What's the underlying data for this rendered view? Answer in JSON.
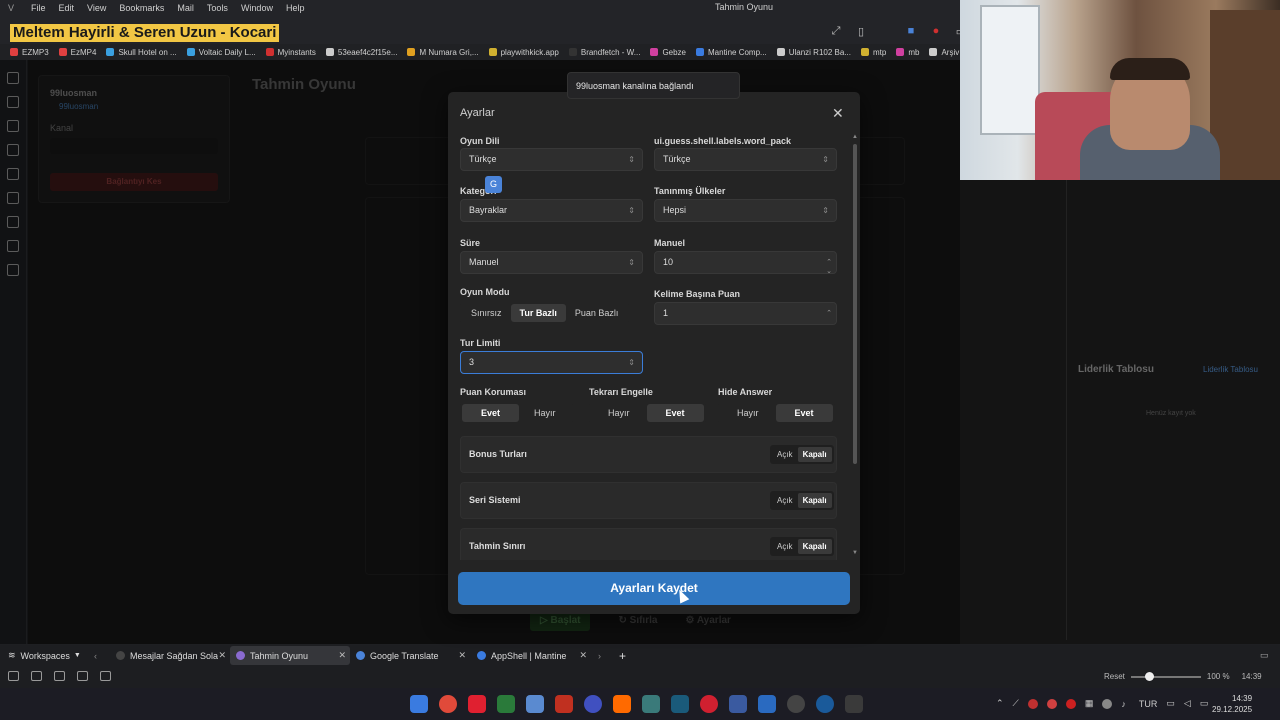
{
  "menu": {
    "items": [
      "File",
      "Edit",
      "View",
      "Bookmarks",
      "Mail",
      "Tools",
      "Window",
      "Help"
    ],
    "window_title": "Tahmin Oyunu"
  },
  "overlay_title": "Meltem Hayirli & Seren Uzun - Kocari",
  "bookmarks": [
    {
      "label": "EZMP3",
      "color": "#e04040"
    },
    {
      "label": "EzMP4",
      "color": "#e04040"
    },
    {
      "label": "Skull Hotel on ...",
      "color": "#3aa0e0"
    },
    {
      "label": "Voltaic Daily L...",
      "color": "#3aa0e0"
    },
    {
      "label": "Myinstants",
      "color": "#d03030"
    },
    {
      "label": "53eaef4c2f15e...",
      "color": "#cccccc"
    },
    {
      "label": "M Numara Gri,...",
      "color": "#e0a020"
    },
    {
      "label": "playwithkick.app",
      "color": "#d0b030"
    },
    {
      "label": "Brandfetch - W...",
      "color": "#333333"
    },
    {
      "label": "Gebze",
      "color": "#d040a0"
    },
    {
      "label": "Mantine Comp...",
      "color": "#3a7be0"
    },
    {
      "label": "Ulanzi R102 Ba...",
      "color": "#cccccc"
    },
    {
      "label": "mtp",
      "color": "#d0b030"
    },
    {
      "label": "mb",
      "color": "#d040a0"
    },
    {
      "label": "Arşiv",
      "color": "#cccccc"
    }
  ],
  "app": {
    "title": "Tahmin Oyunu",
    "user": "99luosman",
    "user_sub": "99luosman",
    "channel_label": "Kanal",
    "disconnect": "Bağlantıyı Kes",
    "start": "Başlat",
    "reset": "Sıfırla",
    "settings": "Ayarlar",
    "leaderboard_title": "Liderlik Tablosu",
    "leaderboard_link": "Liderlik Tablosu",
    "leaderboard_empty": "Henüz kayıt yok"
  },
  "toast": "99luosman kanalına bağlandı",
  "modal": {
    "title": "Ayarlar",
    "language_label": "Oyun Dili",
    "language_value": "Türkçe",
    "wordpack_label": "ui.guess.shell.labels.word_pack",
    "wordpack_value": "Türkçe",
    "category_label": "Kategori",
    "category_value": "Bayraklar",
    "known_label": "Tanınmış Ülkeler",
    "known_value": "Hepsi",
    "duration_label": "Süre",
    "duration_value": "Manuel",
    "manual_label": "Manuel",
    "manual_value": "10",
    "mode_label": "Oyun Modu",
    "mode_options": [
      "Sınırsız",
      "Tur Bazlı",
      "Puan Bazlı"
    ],
    "mode_selected": "Tur Bazlı",
    "points_label": "Kelime Başına Puan",
    "points_value": "1",
    "round_limit_label": "Tur Limiti",
    "round_limit_value": "3",
    "protect_label": "Puan Koruması",
    "protect_options": [
      "Evet",
      "Hayır"
    ],
    "repeat_label": "Tekrarı Engelle",
    "repeat_options": [
      "Hayır",
      "Evet"
    ],
    "hide_label": "Hide Answer",
    "hide_options": [
      "Hayır",
      "Evet"
    ],
    "toggle_rows": [
      {
        "label": "Bonus Turları",
        "on": "Açık",
        "off": "Kapalı"
      },
      {
        "label": "Seri Sistemi",
        "on": "Açık",
        "off": "Kapalı"
      },
      {
        "label": "Tahmin Sınırı",
        "on": "Açık",
        "off": "Kapalı"
      }
    ],
    "save": "Ayarları Kaydet"
  },
  "tabs": {
    "workspaces": "Workspaces",
    "items": [
      {
        "label": "Mesajlar Sağdan Sola",
        "color": "#444444"
      },
      {
        "label": "Tahmin Oyunu",
        "color": "#8a6ad0"
      },
      {
        "label": "Google Translate",
        "color": "#4a83d8"
      },
      {
        "label": "AppShell | Mantine",
        "color": "#3a7be0"
      }
    ]
  },
  "status": {
    "reset": "Reset",
    "zoom": "100 %",
    "time": "14:39"
  },
  "taskbar": {
    "lang": "TUR",
    "time": "14:39",
    "date": "29.12.2025",
    "app_colors": [
      "#3a7be0",
      "#e04a3a",
      "#e02030",
      "#2a7a3a",
      "#5a8ad0",
      "#c03020",
      "#4050c0",
      "#ff6a00",
      "#3a7a7a",
      "#1a5a7a",
      "#d02030",
      "#3a5aa0",
      "#2a6ac0",
      "#444444",
      "#1a5a9a",
      "#3a3a3a"
    ]
  }
}
